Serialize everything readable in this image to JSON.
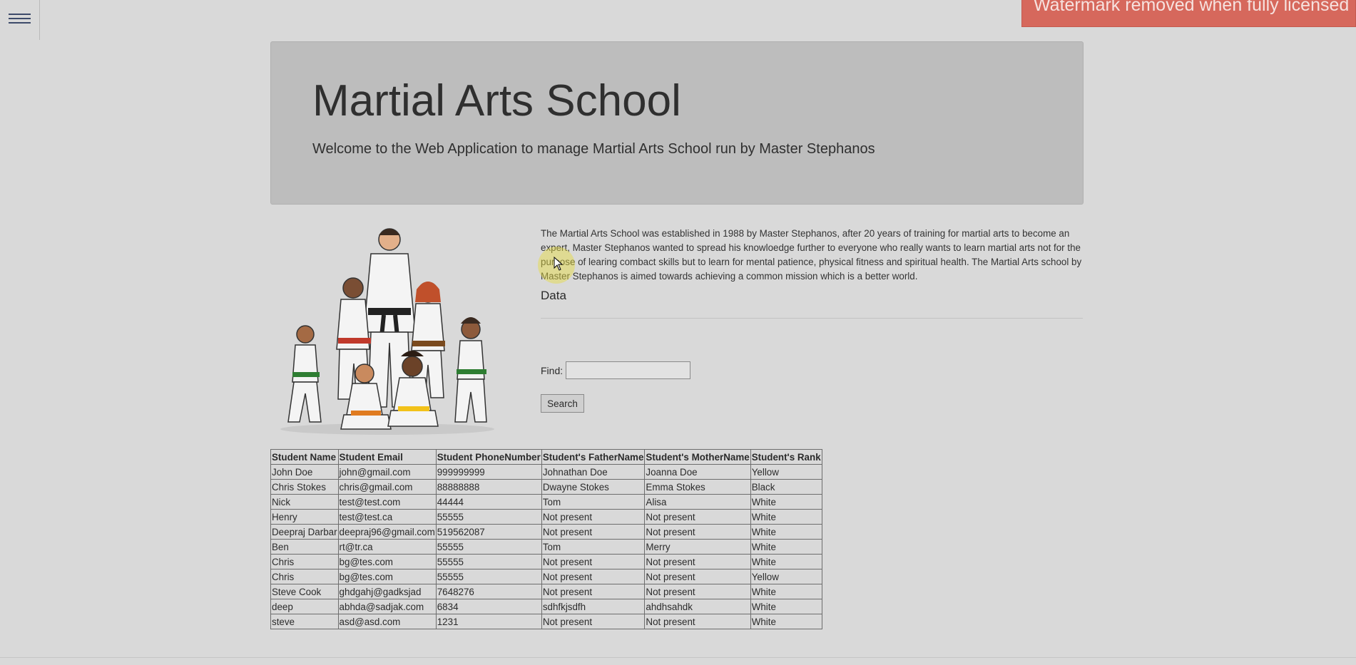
{
  "watermark": "Watermark removed when fully licensed",
  "header": {
    "title": "Martial Arts School",
    "subtitle": "Welcome to the Web Application to manage Martial Arts School run by Master Stephanos"
  },
  "about": "The Martial Arts School was established in 1988 by Master Stephanos, after 20 years of training for martial arts to become an expert, Master Stephanos wanted to spread his knowloedge further to everyone who really wants to learn martial arts not for the purpose of learing combact skills but to learn for mental patience, physical fitness and spiritual health. The Martial Arts school by Master Stephanos is aimed towards achieving a common mission which is a better world.",
  "data_section": {
    "heading": "Data",
    "find_label": "Find:",
    "find_value": "",
    "search_label": "Search"
  },
  "table": {
    "headers": [
      "Student Name",
      "Student Email",
      "Student PhoneNumber",
      "Student's FatherName",
      "Student's MotherName",
      "Student's Rank"
    ],
    "rows": [
      [
        "John Doe",
        "john@gmail.com",
        "999999999",
        "Johnathan Doe",
        "Joanna Doe",
        "Yellow"
      ],
      [
        "Chris Stokes",
        "chris@gmail.com",
        "88888888",
        "Dwayne Stokes",
        "Emma Stokes",
        "Black"
      ],
      [
        "Nick",
        "test@test.com",
        "44444",
        "Tom",
        "Alisa",
        "White"
      ],
      [
        "Henry",
        "test@test.ca",
        "55555",
        "Not present",
        "Not present",
        "White"
      ],
      [
        "Deepraj Darbar",
        "deepraj96@gmail.com",
        "519562087",
        "Not present",
        "Not present",
        "White"
      ],
      [
        "Ben",
        "rt@tr.ca",
        "55555",
        "Tom",
        "Merry",
        "White"
      ],
      [
        "Chris",
        "bg@tes.com",
        "55555",
        "Not present",
        "Not present",
        "White"
      ],
      [
        "Chris",
        "bg@tes.com",
        "55555",
        "Not present",
        "Not present",
        "Yellow"
      ],
      [
        "Steve Cook",
        "ghdgahj@gadksjad",
        "7648276",
        "Not present",
        "Not present",
        "White"
      ],
      [
        "deep",
        "abhda@sadjak.com",
        "6834",
        "sdhfkjsdfh",
        "ahdhsahdk",
        "White"
      ],
      [
        "steve",
        "asd@asd.com",
        "1231",
        "Not present",
        "Not present",
        "White"
      ]
    ]
  },
  "icons": {
    "menu": "hamburger-menu-icon",
    "illustration": "martial-arts-family-illustration",
    "cursor": "mouse-cursor-icon"
  }
}
